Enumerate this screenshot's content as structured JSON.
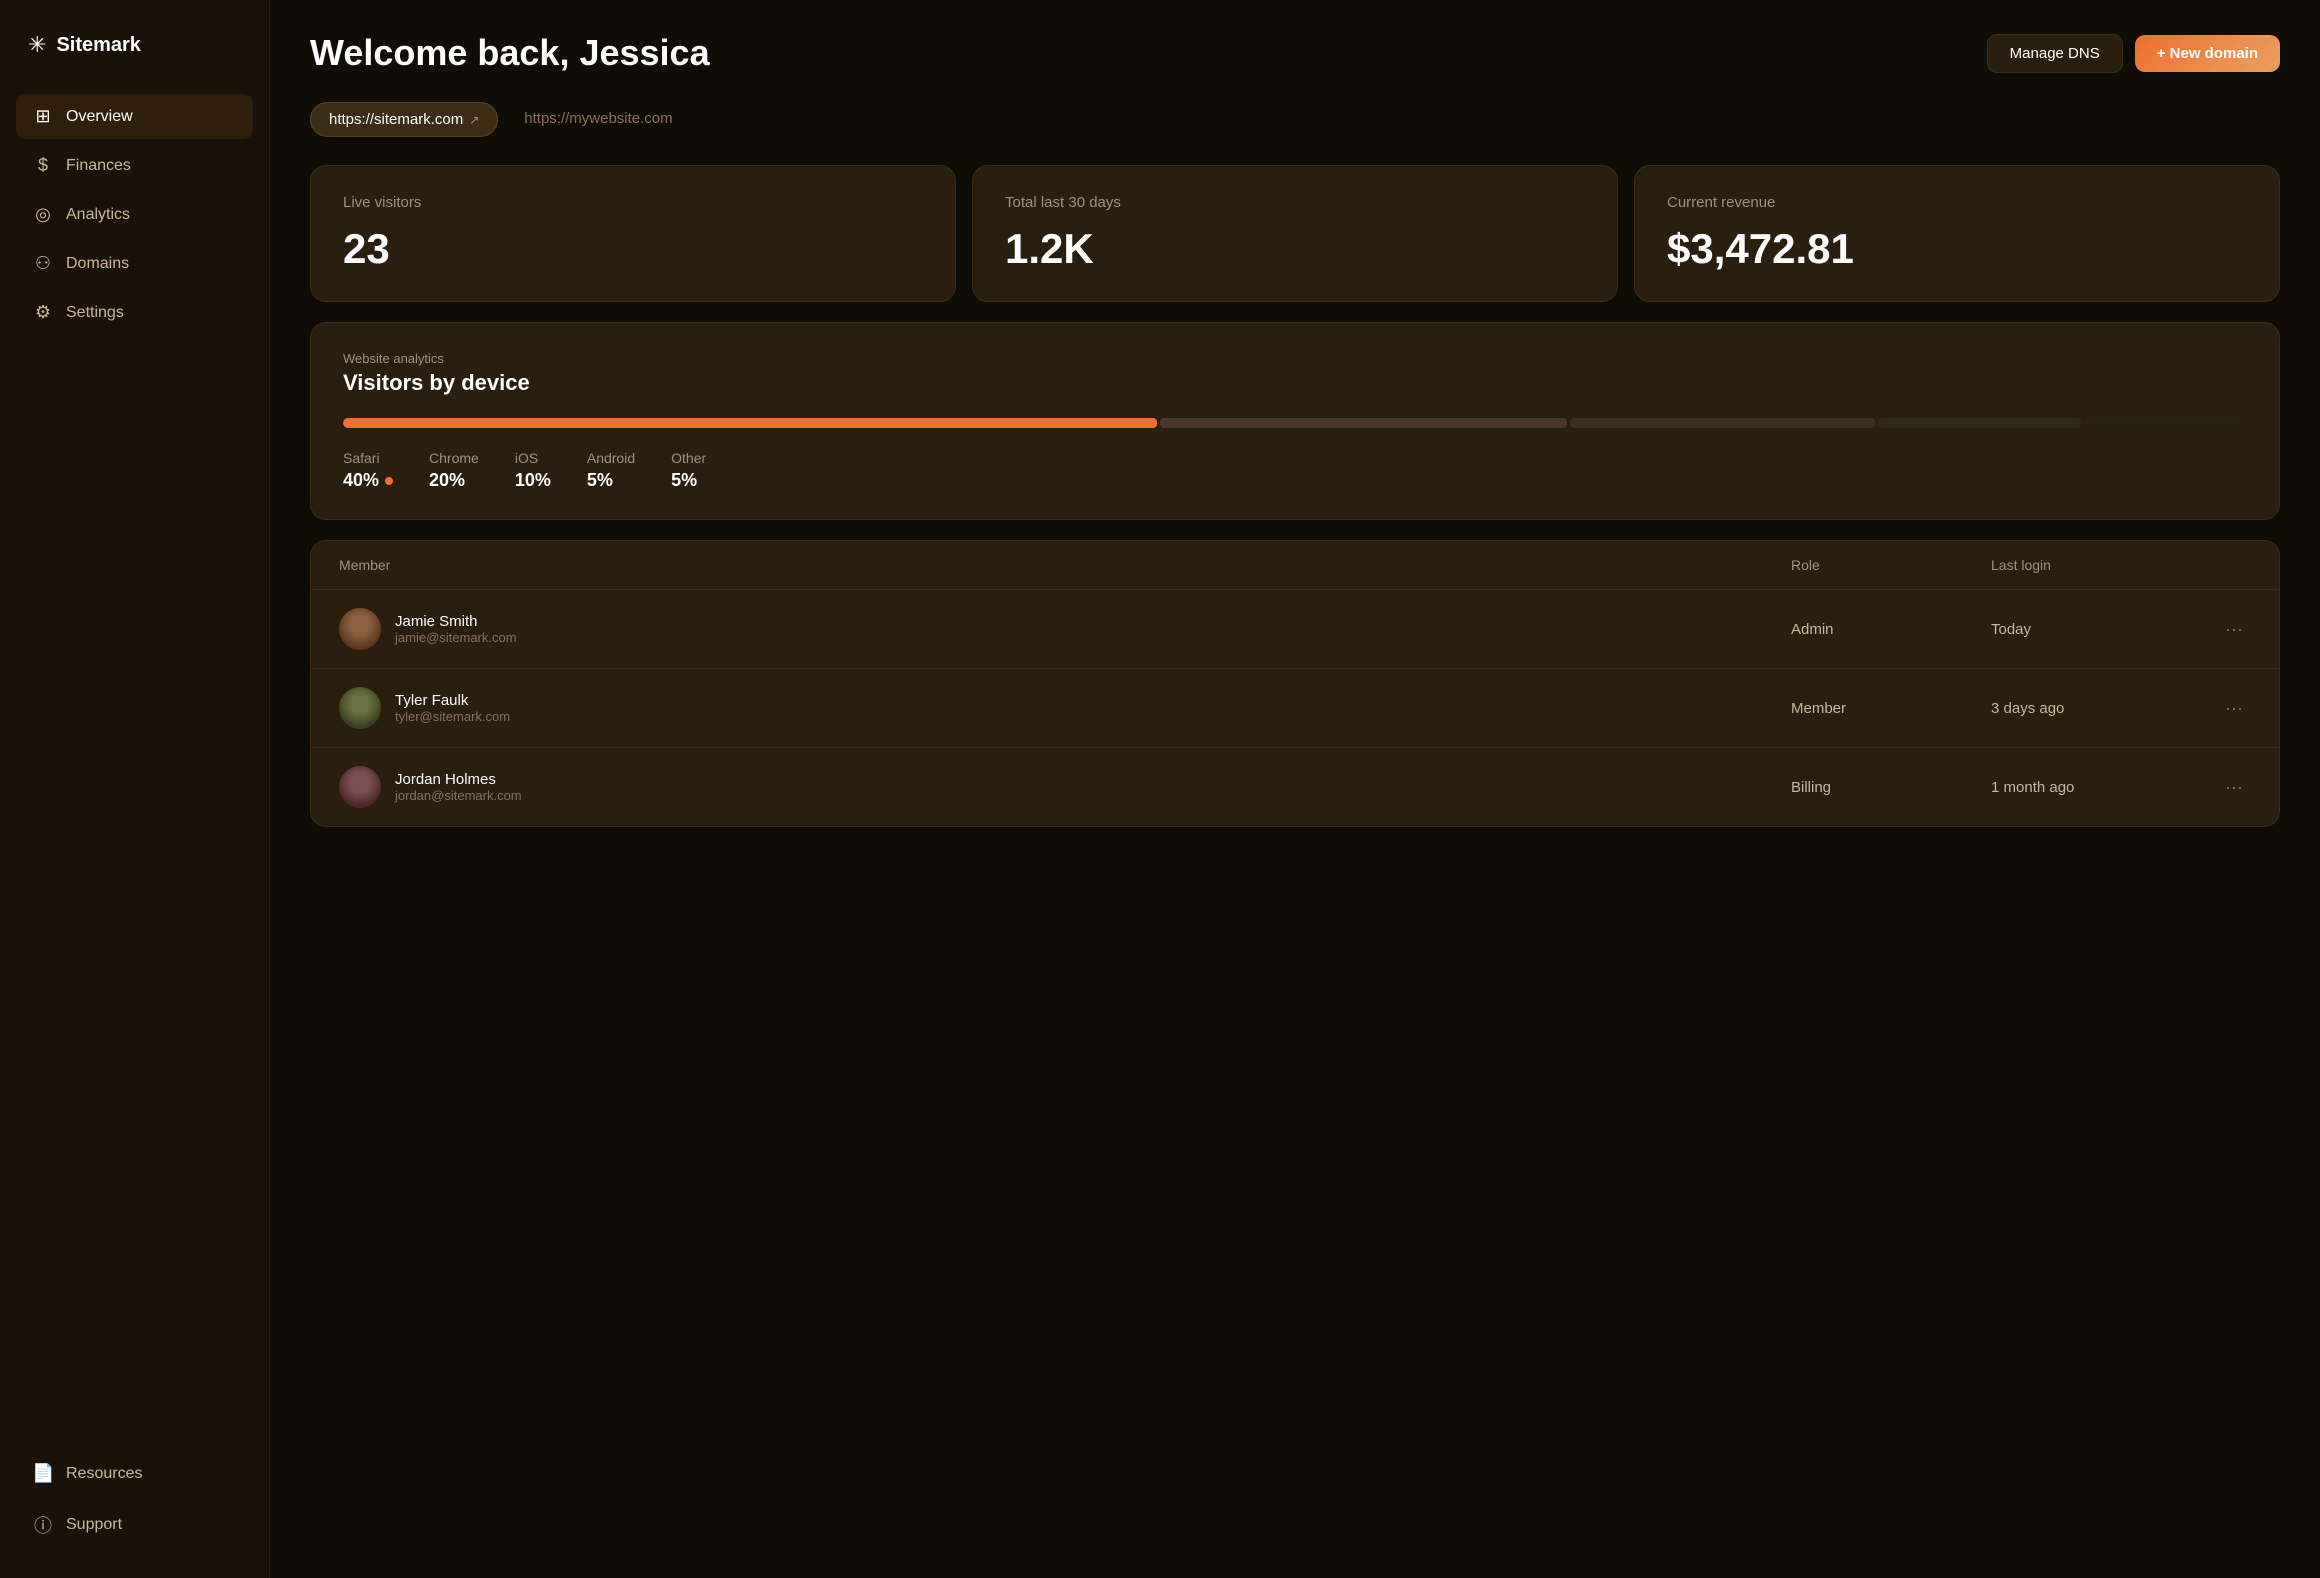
{
  "logo": {
    "text": "Sitemark"
  },
  "sidebar": {
    "nav_items": [
      {
        "id": "overview",
        "label": "Overview",
        "icon": "⊞",
        "active": true
      },
      {
        "id": "finances",
        "label": "Finances",
        "icon": "$",
        "active": false
      },
      {
        "id": "analytics",
        "label": "Analytics",
        "icon": "◎",
        "active": false
      },
      {
        "id": "domains",
        "label": "Domains",
        "icon": "⚇",
        "active": false
      },
      {
        "id": "settings",
        "label": "Settings",
        "icon": "⚙",
        "active": false
      }
    ],
    "bottom_items": [
      {
        "id": "resources",
        "label": "Resources",
        "icon": "📄"
      },
      {
        "id": "support",
        "label": "Support",
        "icon": "ⓘ"
      }
    ]
  },
  "header": {
    "title": "Welcome back, Jessica",
    "manage_dns_label": "Manage DNS",
    "new_domain_label": "+ New domain"
  },
  "domain_tabs": [
    {
      "id": "sitemark",
      "label": "https://sitemark.com",
      "active": true
    },
    {
      "id": "mywebsite",
      "label": "https://mywebsite.com",
      "active": false
    }
  ],
  "stats": [
    {
      "id": "live-visitors",
      "label": "Live visitors",
      "value": "23"
    },
    {
      "id": "total-30-days",
      "label": "Total last 30 days",
      "value": "1.2K"
    },
    {
      "id": "current-revenue",
      "label": "Current revenue",
      "value": "$3,472.81"
    }
  ],
  "analytics": {
    "subtitle": "Website analytics",
    "title": "Visitors by device",
    "segments": [
      {
        "id": "safari",
        "pct": 40,
        "color": "#f07030",
        "label": "Safari",
        "display": "40%"
      },
      {
        "id": "chrome",
        "pct": 20,
        "color": "#4a3828",
        "label": "Chrome",
        "display": "20%"
      },
      {
        "id": "ios",
        "pct": 15,
        "color": "#3d3020",
        "label": "iOS",
        "display": "10%"
      },
      {
        "id": "android",
        "pct": 10,
        "color": "#302818",
        "label": "Android",
        "display": "5%"
      },
      {
        "id": "other",
        "pct": 8,
        "color": "#282010",
        "label": "Other",
        "display": "5%"
      }
    ]
  },
  "members": {
    "columns": {
      "member": "Member",
      "role": "Role",
      "last_login": "Last login"
    },
    "rows": [
      {
        "id": "jamie",
        "name": "Jamie Smith",
        "email": "jamie@sitemark.com",
        "role": "Admin",
        "last_login": "Today",
        "avatar_class": "avatar-1"
      },
      {
        "id": "tyler",
        "name": "Tyler Faulk",
        "email": "tyler@sitemark.com",
        "role": "Member",
        "last_login": "3 days ago",
        "avatar_class": "avatar-2"
      },
      {
        "id": "jordan",
        "name": "Jordan Holmes",
        "email": "jordan@sitemark.com",
        "role": "Billing",
        "last_login": "1 month ago",
        "avatar_class": "avatar-3"
      }
    ]
  }
}
